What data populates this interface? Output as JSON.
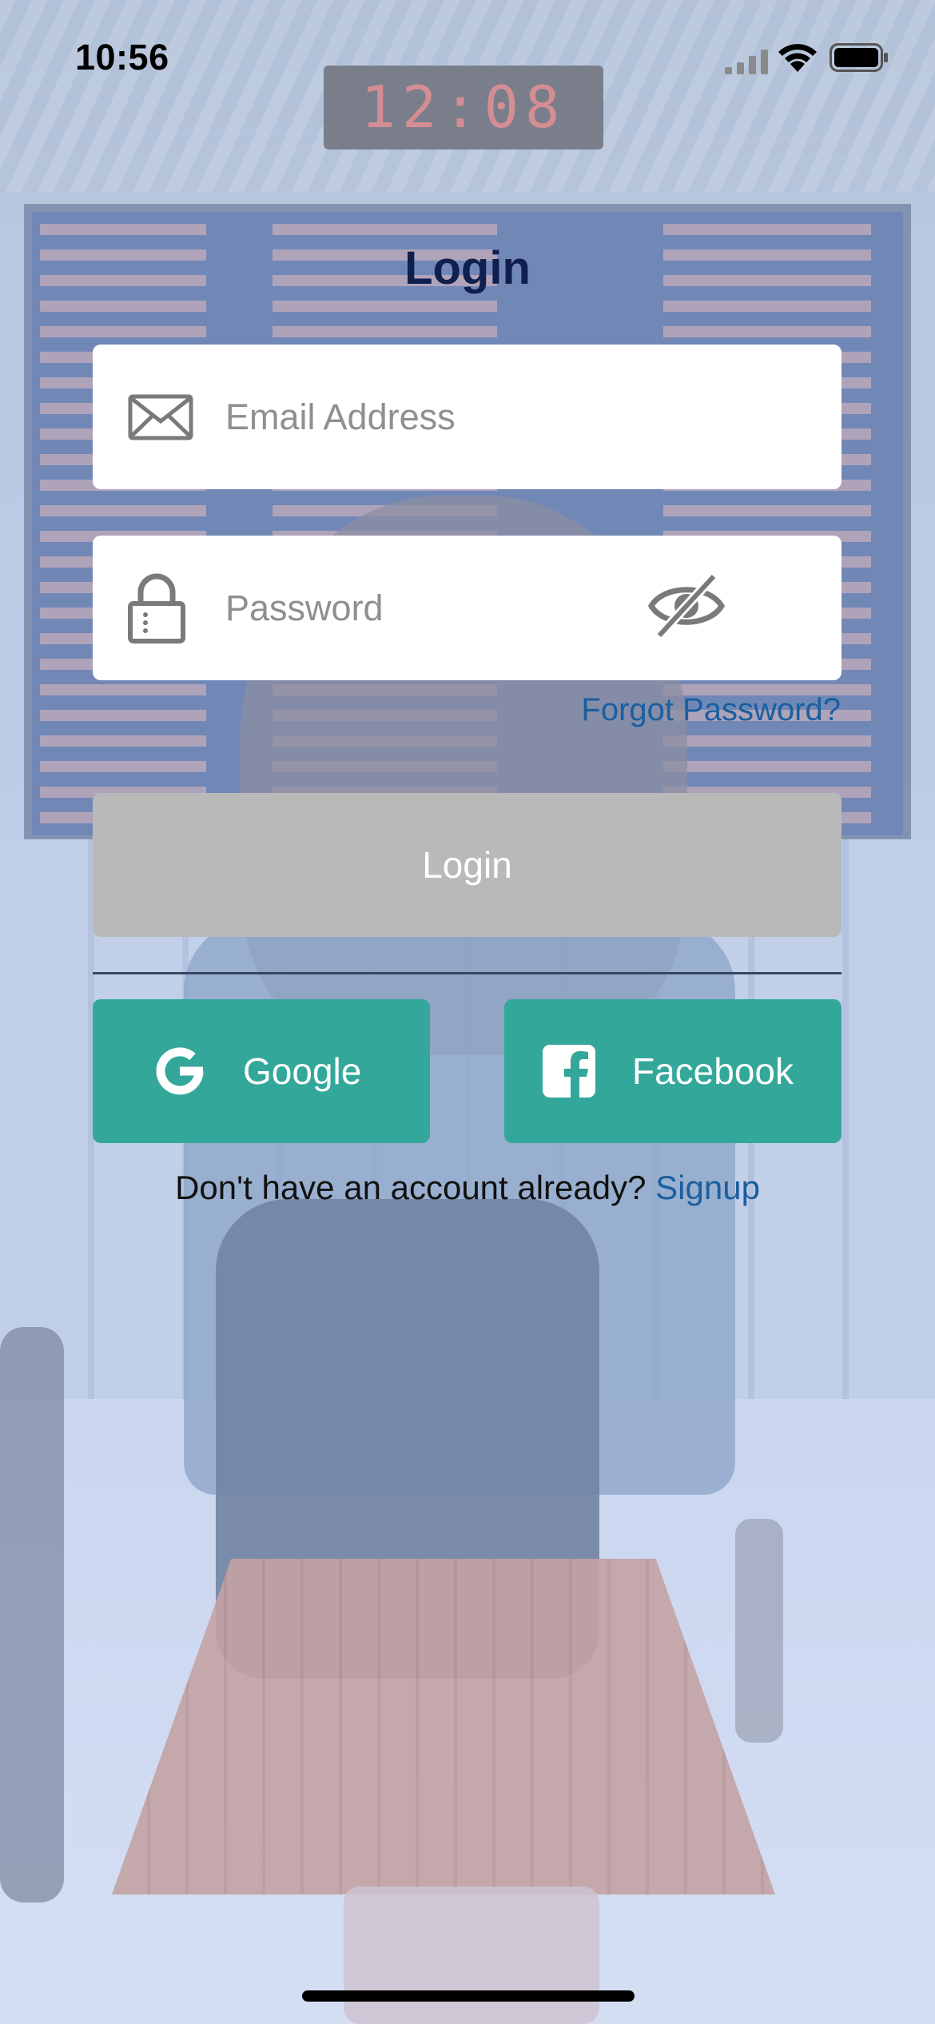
{
  "status_bar": {
    "time": "10:56",
    "icons": [
      "signal-icon",
      "wifi-icon",
      "battery-icon"
    ]
  },
  "login_form": {
    "title": "Login",
    "email": {
      "placeholder": "Email Address",
      "value": "",
      "icon": "mail-icon"
    },
    "password": {
      "placeholder": "Password",
      "value": "",
      "icon": "lock-icon",
      "toggle_icon": "eye-slash-icon"
    },
    "forgot_password_label": "Forgot Password?",
    "login_button_label": "Login"
  },
  "social_login": {
    "google_label": "Google",
    "google_icon": "google-icon",
    "facebook_label": "Facebook",
    "facebook_icon": "facebook-icon"
  },
  "signup": {
    "prompt": "Don't have an account already?",
    "link_label": "Signup"
  },
  "colors": {
    "title": "#0f1f4e",
    "link": "#1a5fa0",
    "login_button_disabled": "#b9b9b9",
    "social_button": "#33a79a",
    "field_background": "#ffffff"
  }
}
